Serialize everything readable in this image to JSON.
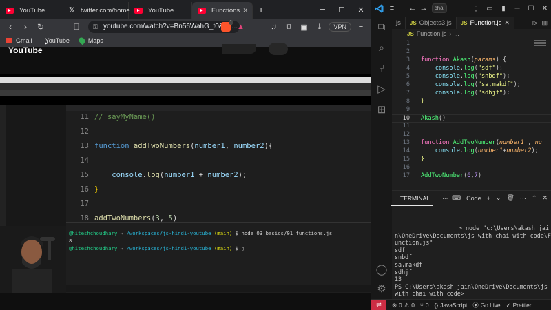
{
  "browser": {
    "tabs": [
      {
        "label": "YouTube",
        "icon": "youtube-icon"
      },
      {
        "label": "twitter.com/home",
        "icon": "x-icon"
      },
      {
        "label": "YouTube",
        "icon": "youtube-icon"
      },
      {
        "label": "Functions ",
        "icon": "youtube-icon",
        "active": true
      }
    ],
    "url": "youtube.com/watch?v=Bn56WahG_t0&list...",
    "vpn_label": "VPN",
    "brave_badge_count": "1",
    "bookmarks": [
      {
        "label": "Gmail"
      },
      {
        "label": "YouTube"
      },
      {
        "label": "Maps"
      }
    ],
    "yt_logo": "YouTube"
  },
  "video": {
    "code_lines": [
      {
        "n": "11",
        "text": "// sayMyName()"
      },
      {
        "n": "12",
        "text": ""
      },
      {
        "n": "13",
        "text": "function addTwoNumbers(number1, number2){"
      },
      {
        "n": "14",
        "text": ""
      },
      {
        "n": "15",
        "text": "    console.log(number1 + number2);"
      },
      {
        "n": "16",
        "text": "}"
      },
      {
        "n": "17",
        "text": ""
      },
      {
        "n": "18",
        "text": "addTwoNumbers(3, 5)"
      }
    ],
    "terminal": {
      "line1_user": "@hiteshchoudhary",
      "line1_path": "/workspaces/js-hindi-youtube",
      "line1_branch": "(main)",
      "line1_cmd": "$ node 03_basics/01_functions.js",
      "output": "8",
      "line3_user": "@hiteshchoudhary",
      "line3_path": "/workspaces/js-hindi-youtube",
      "line3_branch": "(main)",
      "line3_cmd": "$"
    }
  },
  "vscode": {
    "command_center": "chai",
    "tabs": [
      {
        "label": "js",
        "active": false
      },
      {
        "label": "Objects3.js",
        "active": false
      },
      {
        "label": "Function.js",
        "active": true
      }
    ],
    "breadcrumb_file": "Function.js",
    "breadcrumb_more": "...",
    "code": [
      {
        "n": "1",
        "text": ""
      },
      {
        "n": "2",
        "text": ""
      },
      {
        "n": "3",
        "text": "function Akash(params) {"
      },
      {
        "n": "4",
        "text": "    console.log(\"sdf\");"
      },
      {
        "n": "5",
        "text": "    console.log(\"snbdf\");"
      },
      {
        "n": "6",
        "text": "    console.log(\"sa,makdf\");"
      },
      {
        "n": "7",
        "text": "    console.log(\"sdhjf\");"
      },
      {
        "n": "8",
        "text": "}"
      },
      {
        "n": "9",
        "text": ""
      },
      {
        "n": "10",
        "text": "Akash()"
      },
      {
        "n": "11",
        "text": ""
      },
      {
        "n": "12",
        "text": ""
      },
      {
        "n": "13",
        "text": "function AddTwoNumber(number1 , nu"
      },
      {
        "n": "14",
        "text": "    console.log(number1+number2);"
      },
      {
        "n": "15",
        "text": "}"
      },
      {
        "n": "16",
        "text": ""
      },
      {
        "n": "17",
        "text": "AddTwoNumber(6,7)"
      }
    ],
    "panel": {
      "tab": "TERMINAL",
      "shell_label": "Code",
      "add_label": "+"
    },
    "terminal_lines": [
      "> node \"c:\\Users\\akash jai",
      "n\\OneDrive\\Documents\\js with chai with code\\F",
      "unction.js\"",
      "sdf",
      "snbdf",
      "sa,makdf",
      "sdhjf",
      "13",
      "PS C:\\Users\\akash jain\\OneDrive\\Documents\\js",
      "with chai with code>"
    ],
    "status": {
      "errors": "0",
      "warnings": "0",
      "ports": "0",
      "language": "JavaScript",
      "golive": "Go Live",
      "prettier": "Prettier"
    }
  }
}
